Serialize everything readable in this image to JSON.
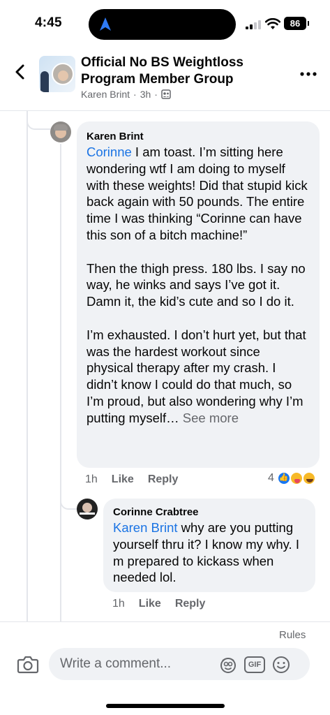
{
  "status_bar": {
    "time": "4:45",
    "battery": "86"
  },
  "header": {
    "title": "Official No BS Weightloss Program Member Group",
    "author": "Karen Brint",
    "age": "3h",
    "separator": "·"
  },
  "comments": [
    {
      "author": "Karen Brint",
      "mention": "Corinne",
      "paragraphs": [
        " I am toast.  I’m sitting here wondering wtf I am doing to myself with these weights!  Did that stupid kick back again with 50 pounds. The entire time I was thinking “Corinne can have this son of a bitch machine!”",
        "Then the thigh press. 180 lbs.  I say no way, he winks and says I’ve got it.  Damn it, the kid’s cute and so I do it.",
        "I’m exhausted. I don’t hurt yet, but that was the hardest workout since physical therapy after my crash.   I didn’t know I could do that much, so I’m proud, but also wondering why I’m putting myself…"
      ],
      "see_more": "See more",
      "time": "1h",
      "like_label": "Like",
      "reply_label": "Reply",
      "reaction_count": "4",
      "reactions": [
        "like-icon",
        "care-icon",
        "haha-icon"
      ]
    },
    {
      "author": "Corinne Crabtree",
      "mention": "Karen Brint",
      "text": " why are you putting yourself thru it? I know my why. I m prepared to kickass when needed lol.",
      "time": "1h",
      "like_label": "Like",
      "reply_label": "Reply"
    }
  ],
  "footer": {
    "rules_label": "Rules",
    "comment_placeholder": "Write a comment...",
    "gif_label": "GIF"
  }
}
